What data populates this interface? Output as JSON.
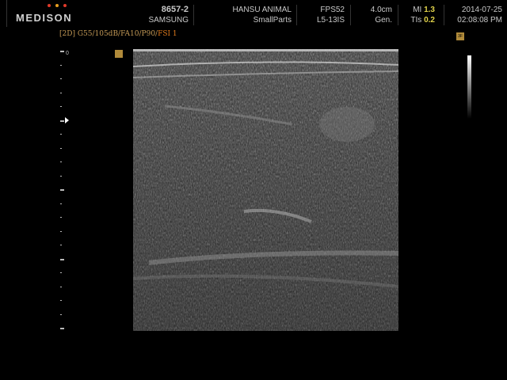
{
  "header": {
    "logo": {
      "text": "MEDISON",
      "dot_colors": [
        "#e03a2a",
        "#e8a020",
        "#e03a2a"
      ]
    },
    "patient": {
      "id": "8657-2",
      "manufacturer": "SAMSUNG"
    },
    "institution": {
      "name": "HANSU ANIMAL",
      "application": "SmallParts"
    },
    "probe": {
      "fps": "FPS52",
      "model": "L5-13IS"
    },
    "depth": {
      "value": "4.0cm",
      "mode": "Gen."
    },
    "index": {
      "mi_label": "MI",
      "mi_value": "1.3",
      "tis_label": "TIs",
      "tis_value": "0.2"
    },
    "datetime": {
      "date": "2014-07-25",
      "time": "02:08:08 PM"
    }
  },
  "mode_line": {
    "params": "[2D] G55/105dB/FA10/P90/",
    "fsi": "FSI 1"
  },
  "scale": {
    "zero_label": "0"
  },
  "icons": {
    "orientation": "orientation-marker-icon",
    "grayscale": "grayscale-map-icon",
    "grayscale_label": "3F"
  },
  "colors": {
    "accent_yellow": "#e0d24a",
    "mode_text": "#c49a56",
    "fsi_text": "#e07a1c"
  }
}
